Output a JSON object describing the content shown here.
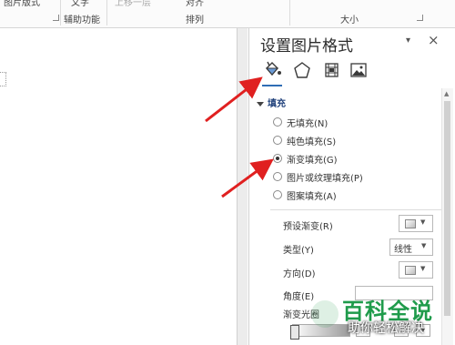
{
  "ribbon": {
    "left_top_label": "图片版式",
    "text_top_label": "文字",
    "assist_label": "辅助功能",
    "arrange_top_left": "上移一层",
    "arrange_top_right": "对齐",
    "arrange_label": "排列",
    "size_label": "大小"
  },
  "pane": {
    "title": "设置图片格式",
    "menu_glyph": "▾",
    "close_glyph": "×",
    "tabs": [
      {
        "name": "fill-line-icon"
      },
      {
        "name": "effects-icon"
      },
      {
        "name": "layout-properties-icon"
      },
      {
        "name": "picture-icon"
      }
    ],
    "section": "填充",
    "fill_options": [
      {
        "label": "无填充(N)",
        "checked": false
      },
      {
        "label": "纯色填充(S)",
        "checked": false
      },
      {
        "label": "渐变填充(G)",
        "checked": true
      },
      {
        "label": "图片或纹理填充(P)",
        "checked": false
      },
      {
        "label": "图案填充(A)",
        "checked": false
      }
    ],
    "preset_gradient_label": "预设渐变(R)",
    "type_label": "类型(Y)",
    "type_value": "线性",
    "direction_label": "方向(D)",
    "angle_label": "角度(E)",
    "gradient_stops_label": "渐变光圈"
  },
  "watermark": {
    "title": "百科全说",
    "subtitle": "助你轻松解决"
  },
  "colors": {
    "accent_blue": "#2f6db5",
    "arrow_red": "#e02020",
    "watermark_green": "#1f9b4b"
  }
}
